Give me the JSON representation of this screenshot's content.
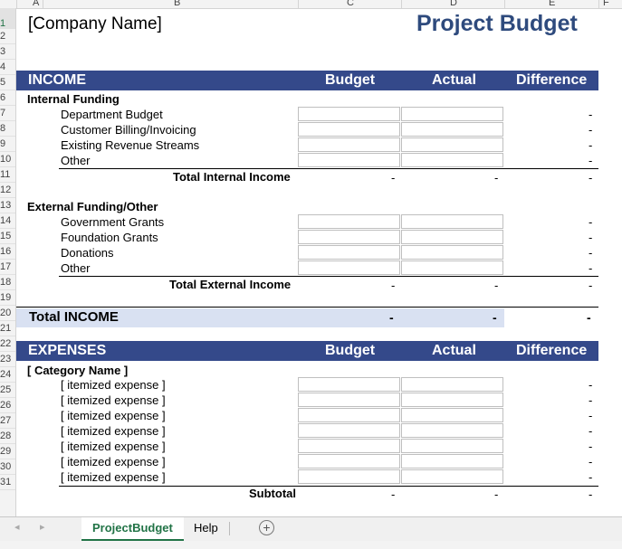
{
  "columns": [
    "A",
    "B",
    "C",
    "D",
    "E",
    "F"
  ],
  "rows": [
    "1",
    "2",
    "3",
    "4",
    "5",
    "6",
    "7",
    "8",
    "9",
    "10",
    "11",
    "12",
    "13",
    "14",
    "15",
    "16",
    "17",
    "18",
    "19",
    "20",
    "21",
    "22",
    "23",
    "24",
    "25",
    "26",
    "27",
    "28",
    "29",
    "30",
    "31"
  ],
  "header": {
    "company": "[Company Name]",
    "title": "Project Budget"
  },
  "income": {
    "label": "INCOME",
    "col_budget": "Budget",
    "col_actual": "Actual",
    "col_diff": "Difference",
    "internal": {
      "label": "Internal Funding",
      "items": [
        "Department Budget",
        "Customer Billing/Invoicing",
        "Existing Revenue Streams",
        "Other"
      ],
      "total_label": "Total Internal Income"
    },
    "external": {
      "label": "External Funding/Other",
      "items": [
        "Government Grants",
        "Foundation Grants",
        "Donations",
        "Other"
      ],
      "total_label": "Total External Income"
    },
    "total_label": "Total INCOME"
  },
  "expenses": {
    "label": "EXPENSES",
    "col_budget": "Budget",
    "col_actual": "Actual",
    "col_diff": "Difference",
    "category": "[ Category Name ]",
    "item_label": "[ itemized expense ]",
    "item_count": 7,
    "subtotal_label": "Subtotal"
  },
  "dash": "-",
  "tabs": {
    "project": "ProjectBudget",
    "help": "Help",
    "add": "+"
  }
}
